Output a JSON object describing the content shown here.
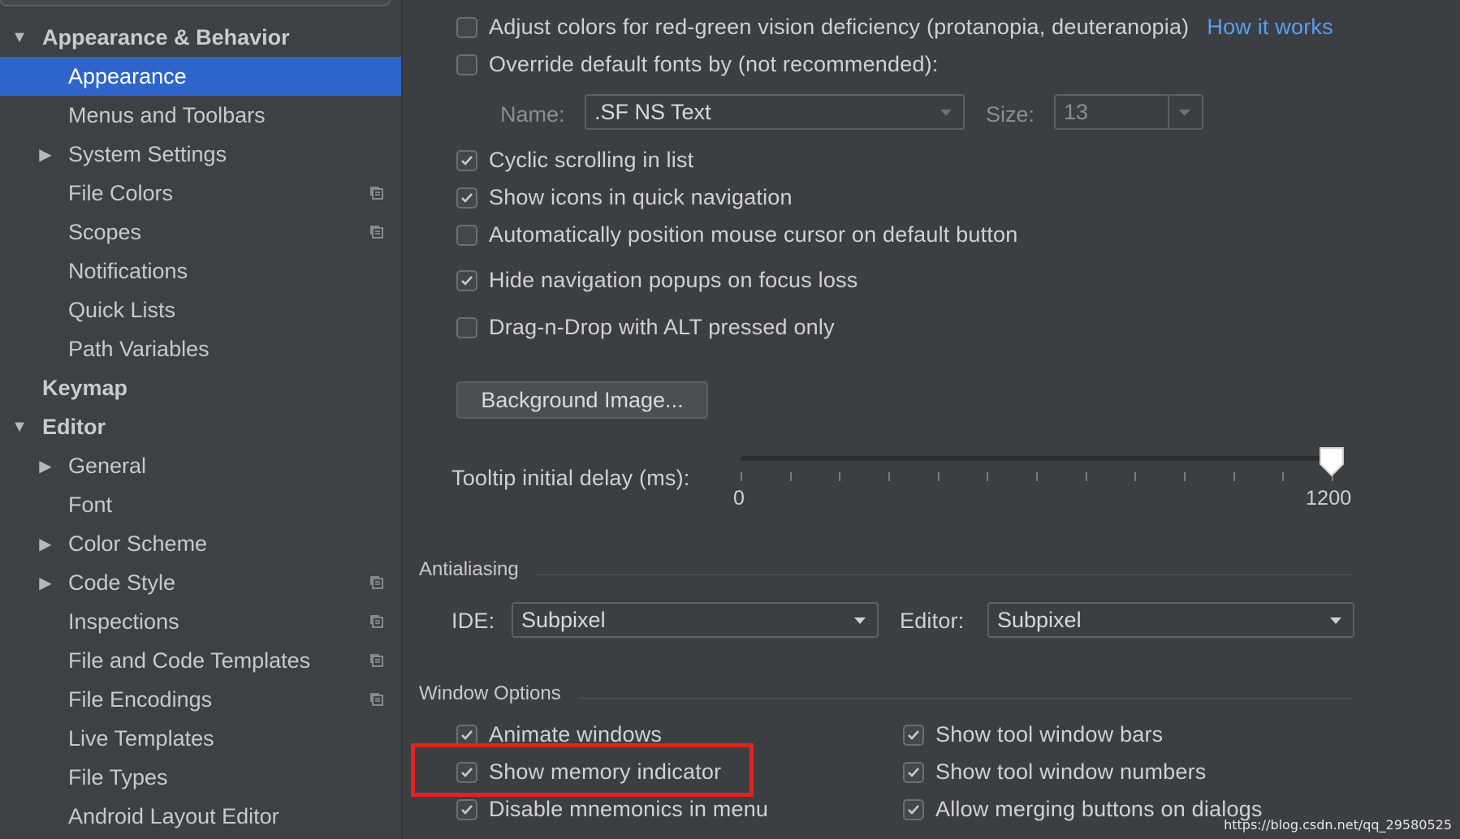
{
  "sidebar": {
    "items": [
      {
        "label": "Appearance & Behavior",
        "expanded": true
      },
      {
        "label": "Appearance",
        "selected": true
      },
      {
        "label": "Menus and Toolbars"
      },
      {
        "label": "System Settings",
        "collapsed": true
      },
      {
        "label": "File Colors",
        "copy_icon": true
      },
      {
        "label": "Scopes",
        "copy_icon": true
      },
      {
        "label": "Notifications"
      },
      {
        "label": "Quick Lists"
      },
      {
        "label": "Path Variables"
      },
      {
        "label": "Keymap"
      },
      {
        "label": "Editor",
        "expanded": true
      },
      {
        "label": "General",
        "collapsed": true
      },
      {
        "label": "Font"
      },
      {
        "label": "Color Scheme",
        "collapsed": true
      },
      {
        "label": "Code Style",
        "collapsed": true,
        "copy_icon": true
      },
      {
        "label": "Inspections",
        "copy_icon": true
      },
      {
        "label": "File and Code Templates",
        "copy_icon": true
      },
      {
        "label": "File Encodings",
        "copy_icon": true
      },
      {
        "label": "Live Templates"
      },
      {
        "label": "File Types"
      },
      {
        "label": "Android Layout Editor"
      }
    ]
  },
  "options": {
    "adjust_colors": {
      "label": "Adjust colors for red-green vision deficiency (protanopia, deuteranopia)",
      "checked": false,
      "link": "How it works"
    },
    "override_fonts": {
      "label": "Override default fonts by (not recommended):",
      "checked": false
    },
    "font_name_label": "Name:",
    "font_name_value": ".SF NS Text",
    "font_size_label": "Size:",
    "font_size_value": "13",
    "cyclic_scrolling": {
      "label": "Cyclic scrolling in list",
      "checked": true
    },
    "show_icons_nav": {
      "label": "Show icons in quick navigation",
      "checked": true
    },
    "auto_mouse": {
      "label": "Automatically position mouse cursor on default button",
      "checked": false
    },
    "hide_nav_popups": {
      "label": "Hide navigation popups on focus loss",
      "checked": true
    },
    "drag_n_drop": {
      "label": "Drag-n-Drop with ALT pressed only",
      "checked": false
    },
    "background_image_button": "Background Image...",
    "tooltip_label": "Tooltip initial delay (ms):",
    "tooltip_min": "0",
    "tooltip_max": "1200",
    "tooltip_value_fraction": 1.0
  },
  "antialiasing": {
    "title": "Antialiasing",
    "ide_label": "IDE:",
    "ide_value": "Subpixel",
    "editor_label": "Editor:",
    "editor_value": "Subpixel"
  },
  "window_options": {
    "title": "Window Options",
    "animate_windows": {
      "label": "Animate windows",
      "checked": true
    },
    "show_memory": {
      "label": "Show memory indicator",
      "checked": true
    },
    "disable_mnemonics": {
      "label": "Disable mnemonics in menu",
      "checked": true
    },
    "show_tool_bars": {
      "label": "Show tool window bars",
      "checked": true
    },
    "show_tool_numbers": {
      "label": "Show tool window numbers",
      "checked": true
    },
    "allow_merging": {
      "label": "Allow merging buttons on dialogs",
      "checked": true
    }
  },
  "watermark": "https://blog.csdn.net/qq_29580525",
  "colors": {
    "selection": "#2f65ca",
    "link": "#589df6",
    "highlight": "#e32222"
  }
}
